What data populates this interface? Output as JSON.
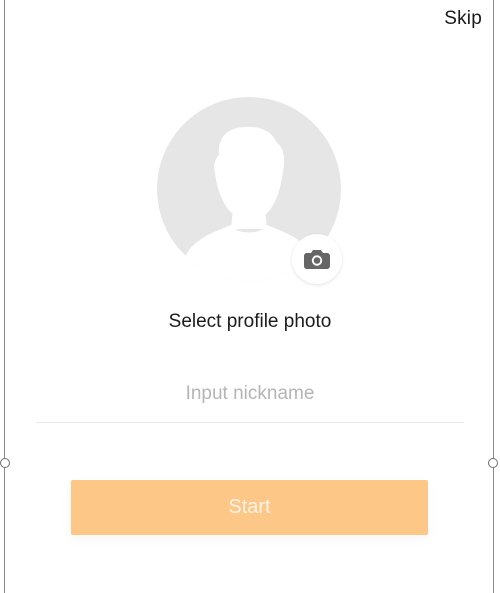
{
  "header": {
    "skip_label": "Skip"
  },
  "profile": {
    "avatar_icon": "person-silhouette-icon",
    "camera_icon": "camera-icon",
    "select_label": "Select profile photo"
  },
  "nickname": {
    "value": "",
    "placeholder": "Input nickname"
  },
  "actions": {
    "start_label": "Start"
  },
  "colors": {
    "accent": "#fdc787",
    "avatar_bg": "#e6e6e6",
    "silhouette": "#ffffff"
  }
}
